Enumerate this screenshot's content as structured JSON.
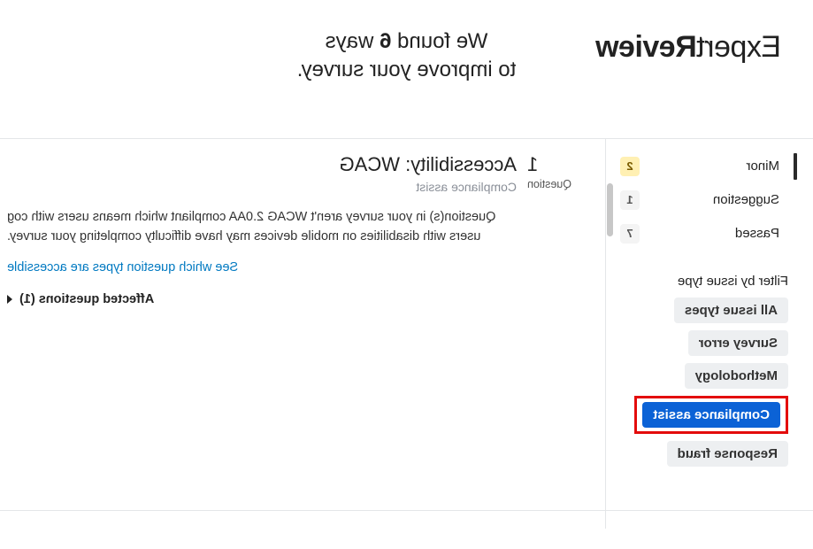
{
  "brand": {
    "light": "Expert",
    "bold": "Review"
  },
  "tagline": {
    "prefix": "We found ",
    "count": "6",
    "suffix": " ways",
    "line2": "to improve your survey."
  },
  "sidebar": {
    "severities": [
      {
        "label": "Minor",
        "count": "2",
        "warn": true,
        "active": true
      },
      {
        "label": "Suggestion",
        "count": "1",
        "warn": false,
        "active": false
      },
      {
        "label": "Passed",
        "count": "7",
        "warn": false,
        "active": false
      }
    ],
    "filter_heading": "Filter by issue type",
    "issue_types": [
      {
        "label": "All issue types",
        "selected": false,
        "highlight": false
      },
      {
        "label": "Survey error",
        "selected": false,
        "highlight": false
      },
      {
        "label": "Methodology",
        "selected": false,
        "highlight": false
      },
      {
        "label": "Compliance assist",
        "selected": true,
        "highlight": true
      },
      {
        "label": "Response fraud",
        "selected": false,
        "highlight": false
      }
    ]
  },
  "content": {
    "q_num": "1",
    "q_word": "Question",
    "title": "Accessibility: WCAG",
    "subtitle": "Compliance assist",
    "body": "Question(s) in your survey aren't WCAG 2.0AA compliant which means users with cog\nusers with disabilities on mobile devices may have difficulty completing your survey.",
    "link": "See which question types are accessible",
    "affected": "Affected questions (1)"
  }
}
